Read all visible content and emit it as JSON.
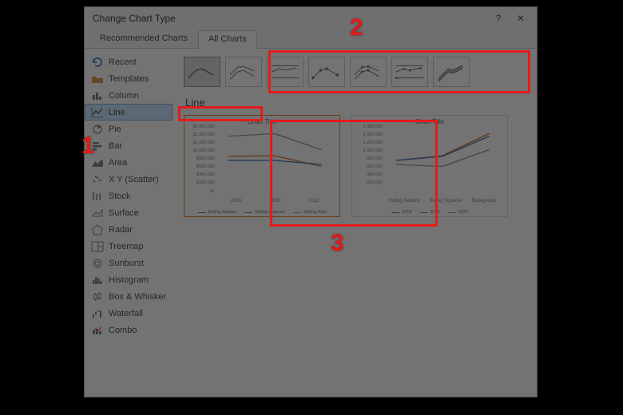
{
  "dialog": {
    "title": "Change Chart Type",
    "help": "?",
    "close": "✕",
    "tabs": {
      "recommended": "Recommended Charts",
      "all": "All Charts"
    }
  },
  "sidebar": {
    "items": [
      {
        "icon": "undo",
        "label": "Recent"
      },
      {
        "icon": "template",
        "label": "Templates"
      },
      {
        "icon": "column",
        "label": "Column"
      },
      {
        "icon": "line",
        "label": "Line"
      },
      {
        "icon": "pie",
        "label": "Pie"
      },
      {
        "icon": "bar",
        "label": "Bar"
      },
      {
        "icon": "area",
        "label": "Area"
      },
      {
        "icon": "scatter",
        "label": "X Y (Scatter)"
      },
      {
        "icon": "stock",
        "label": "Stock"
      },
      {
        "icon": "surface",
        "label": "Surface"
      },
      {
        "icon": "radar",
        "label": "Radar"
      },
      {
        "icon": "treemap",
        "label": "Treemap"
      },
      {
        "icon": "sunburst",
        "label": "Sunburst"
      },
      {
        "icon": "histogram",
        "label": "Histogram"
      },
      {
        "icon": "box",
        "label": "Box & Whisker"
      },
      {
        "icon": "waterfall",
        "label": "Waterfall"
      },
      {
        "icon": "combo",
        "label": "Combo"
      }
    ],
    "selected_index": 3
  },
  "subtypes": {
    "names": [
      "line",
      "stacked-line",
      "100pct-stacked-line",
      "line-markers",
      "stacked-line-markers",
      "100pct-stacked-line-markers",
      "3d-line"
    ],
    "selected_index": 0
  },
  "main": {
    "heading": "Line"
  },
  "previews": {
    "selected_index": 0,
    "items": [
      {
        "title": "Chart Title",
        "ylabels": [
          "$1,400,000",
          "$1,300,000",
          "$1,200,000",
          "$1,000,000",
          "$800,000",
          "$600,000",
          "$400,000",
          "$200,000",
          "$-"
        ],
        "xlabels": [
          "2018",
          "2020",
          "2022"
        ],
        "legend": [
          "Riding Sedans",
          "Riding Superior",
          "Riding Auto"
        ],
        "colors": [
          "#4a7ebb",
          "#d87a3a",
          "#9aa3ac"
        ]
      },
      {
        "title": "Chart Title",
        "ylabels": [
          "1,400,000",
          "1,300,000",
          "1,200,000",
          "1,000,000",
          "800,000",
          "600,000",
          "400,000",
          "200,000",
          "-"
        ],
        "xlabels": [
          "Riding Sedans",
          "Riding Superior",
          "Riding Auto"
        ],
        "legend": [
          "2018",
          "2020",
          "2022"
        ],
        "colors": [
          "#4a7ebb",
          "#d87a3a",
          "#9aa3ac"
        ]
      }
    ]
  },
  "chart_data": [
    {
      "type": "line",
      "title": "Chart Title",
      "xlabel": "",
      "ylabel": "",
      "categories": [
        "2018",
        "2020",
        "2022"
      ],
      "ylim": [
        0,
        1400000
      ],
      "series": [
        {
          "name": "Riding Sedans",
          "color": "#4a7ebb",
          "values": [
            700000,
            700000,
            620000
          ]
        },
        {
          "name": "Riding Superior",
          "color": "#d87a3a",
          "values": [
            780000,
            800000,
            580000
          ]
        },
        {
          "name": "Riding Auto",
          "color": "#9aa3ac",
          "values": [
            1200000,
            1260000,
            920000
          ]
        }
      ]
    },
    {
      "type": "line",
      "title": "Chart Title",
      "xlabel": "",
      "ylabel": "",
      "categories": [
        "Riding Sedans",
        "Riding Superior",
        "Riding Auto"
      ],
      "ylim": [
        0,
        1400000
      ],
      "series": [
        {
          "name": "2018",
          "color": "#4a7ebb",
          "values": [
            700000,
            780000,
            1200000
          ]
        },
        {
          "name": "2020",
          "color": "#d87a3a",
          "values": [
            700000,
            800000,
            1260000
          ]
        },
        {
          "name": "2022",
          "color": "#9aa3ac",
          "values": [
            620000,
            580000,
            920000
          ]
        }
      ]
    }
  ],
  "annotations": {
    "n1": "1",
    "n2": "2",
    "n3": "3"
  }
}
